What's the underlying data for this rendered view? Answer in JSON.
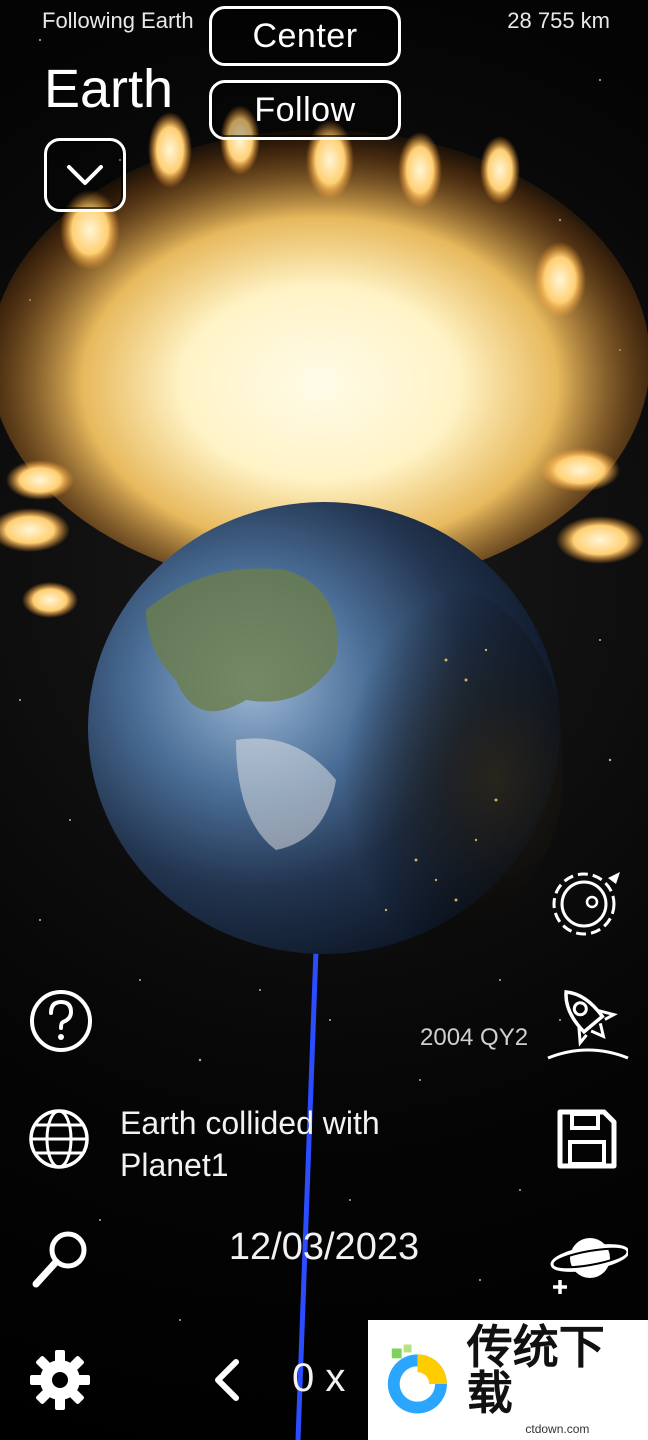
{
  "hud": {
    "following": "Following Earth",
    "distance": "28 755 km",
    "object_name": "Earth",
    "center_label": "Center",
    "follow_label": "Follow"
  },
  "labels": {
    "asteroid": "2004 QY2",
    "event": "Earth collided with Planet1",
    "date": "12/03/2023",
    "speed": "0 x"
  },
  "icons": {
    "dropdown": "chevron-down-icon",
    "help": "question-circle-icon",
    "globe": "globe-icon",
    "search": "magnifier-icon",
    "settings": "gear-icon",
    "prev": "chevron-left-icon",
    "orbit": "orbit-icon",
    "rocket": "rocket-icon",
    "save": "floppy-icon",
    "add_planet": "add-planet-icon"
  },
  "watermark": {
    "title": "传统下载",
    "site": "ctdown.com"
  },
  "colors": {
    "explosion": "#fff2c2",
    "orbit_line": "#2c4cff"
  }
}
